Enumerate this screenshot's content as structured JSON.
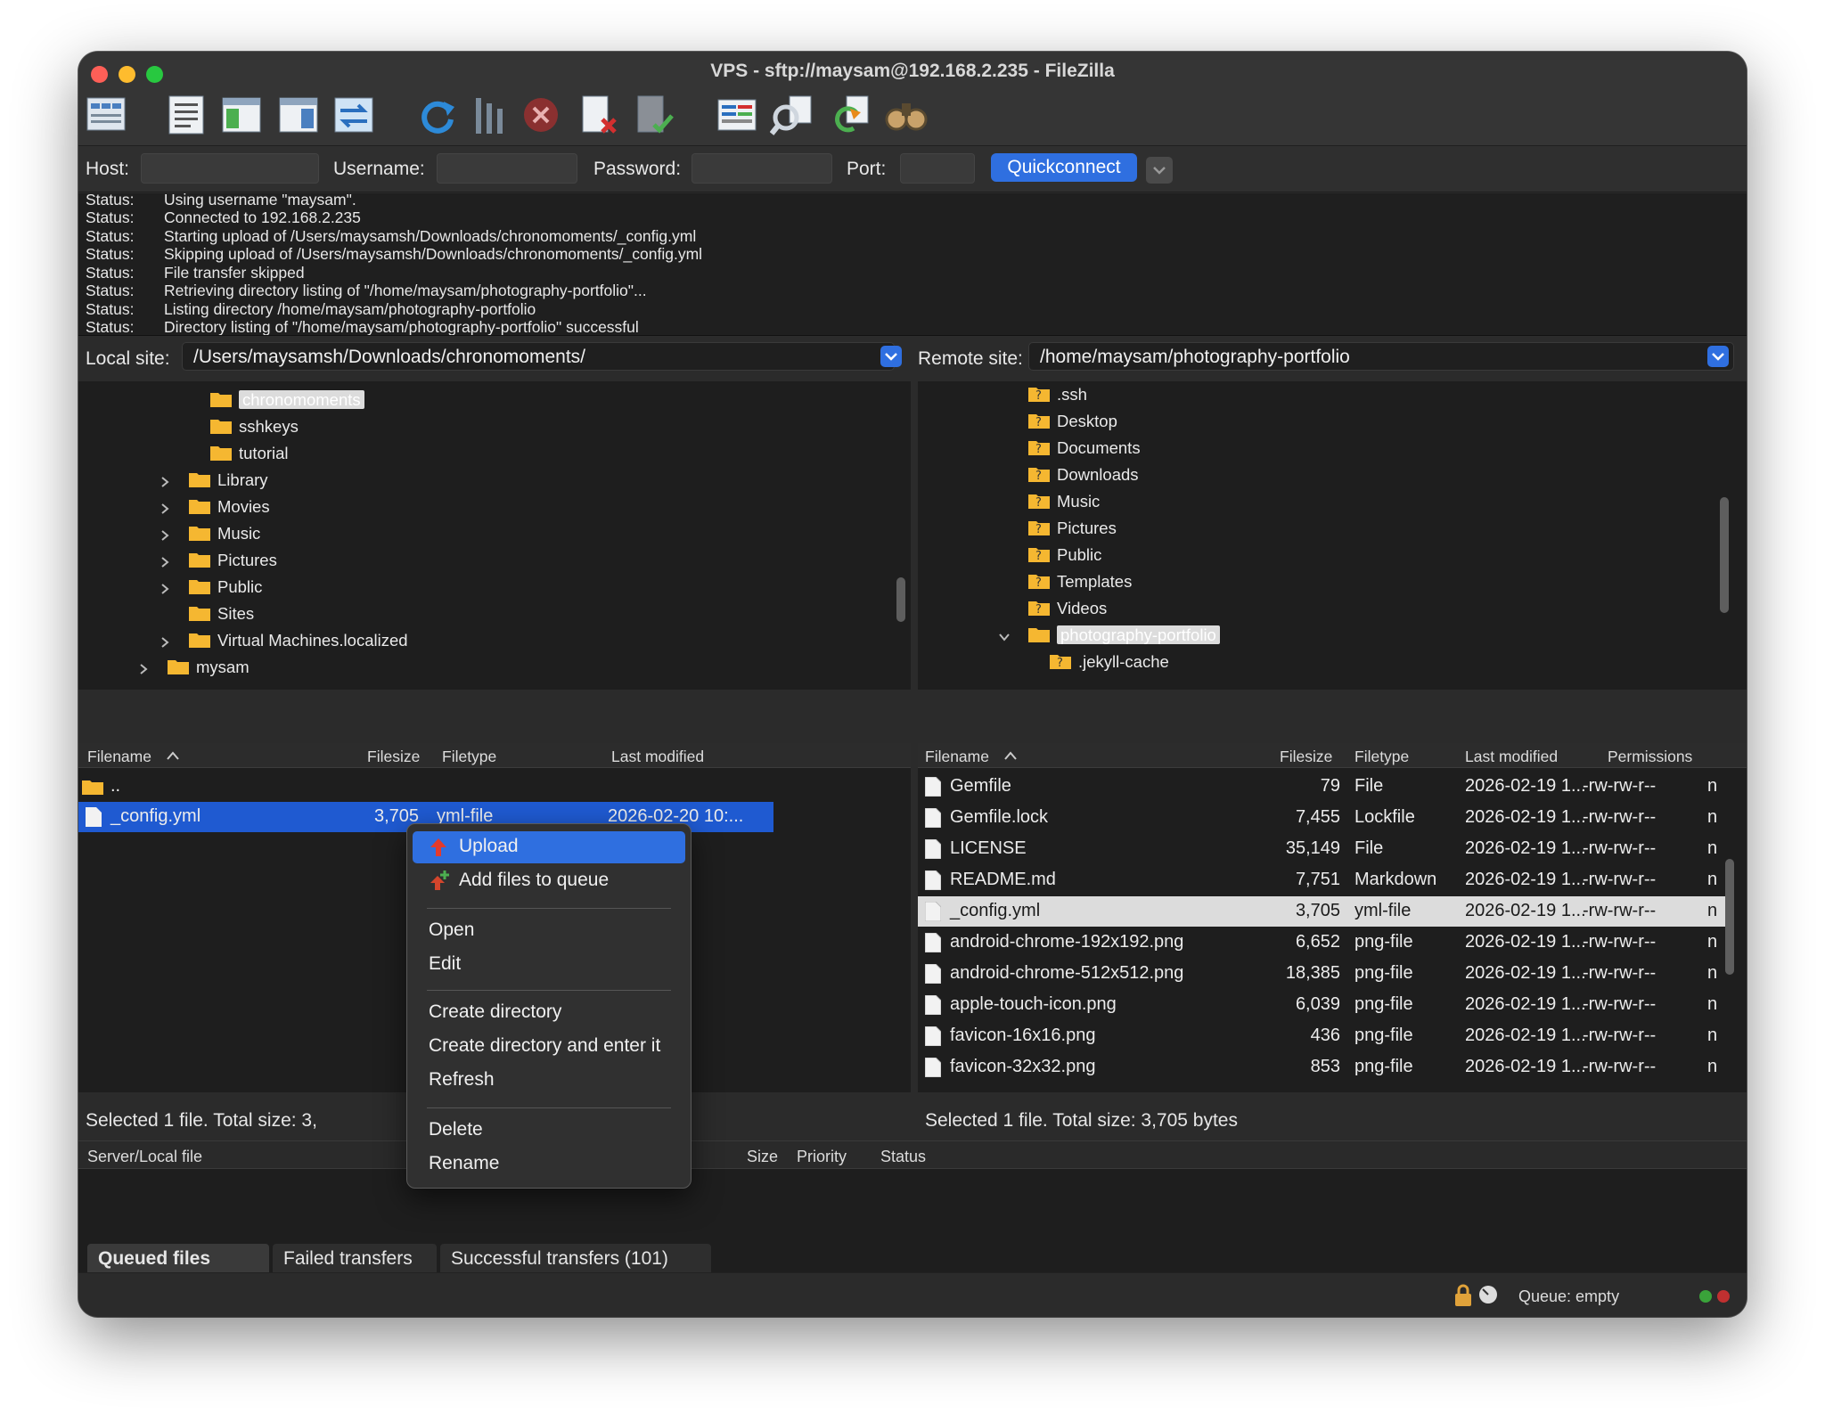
{
  "window": {
    "title": "VPS - sftp://maysam@192.168.2.235 - FileZilla"
  },
  "toolbar": {
    "icons": [
      "site-manager-icon",
      "message-log-icon",
      "local-tree-icon",
      "remote-tree-icon",
      "transfer-queue-icon",
      "refresh-icon",
      "process-queue-icon",
      "cancel-icon",
      "disconnect-icon",
      "reconnect-icon",
      "directory-comparison-icon",
      "filter-icon",
      "sync-browsing-icon",
      "search-icon"
    ]
  },
  "quickconnect": {
    "host_label": "Host:",
    "host_value": "",
    "username_label": "Username:",
    "username_value": "",
    "password_label": "Password:",
    "password_value": "",
    "port_label": "Port:",
    "port_value": "",
    "button": "Quickconnect"
  },
  "log": [
    {
      "type": "Status:",
      "text": "Using username \"maysam\"."
    },
    {
      "type": "Status:",
      "text": "Connected to 192.168.2.235"
    },
    {
      "type": "Status:",
      "text": "Starting upload of /Users/maysamsh/Downloads/chronomoments/_config.yml"
    },
    {
      "type": "Status:",
      "text": "Skipping upload of /Users/maysamsh/Downloads/chronomoments/_config.yml"
    },
    {
      "type": "Status:",
      "text": "File transfer skipped"
    },
    {
      "type": "Status:",
      "text": "Retrieving directory listing of \"/home/maysam/photography-portfolio\"..."
    },
    {
      "type": "Status:",
      "text": "Listing directory /home/maysam/photography-portfolio"
    },
    {
      "type": "Status:",
      "text": "Directory listing of \"/home/maysam/photography-portfolio\" successful"
    }
  ],
  "local": {
    "site_label": "Local site:",
    "path": "/Users/maysamsh/Downloads/chronomoments/",
    "tree": [
      "chronomoments",
      "sshkeys",
      "tutorial",
      "Library",
      "Movies",
      "Music",
      "Pictures",
      "Public",
      "Sites",
      "Virtual Machines.localized",
      "mysam"
    ],
    "columns": [
      "Filename",
      "Filesize",
      "Filetype",
      "Last modified"
    ],
    "parent": "..",
    "files": [
      {
        "name": "_config.yml",
        "size": "3,705",
        "type": "yml-file",
        "modified": "2026-02-20 10:..."
      }
    ],
    "status": "Selected 1 file. Total size: 3,"
  },
  "remote": {
    "site_label": "Remote site:",
    "path": "/home/maysam/photography-portfolio",
    "tree": [
      ".ssh",
      "Desktop",
      "Documents",
      "Downloads",
      "Music",
      "Pictures",
      "Public",
      "Templates",
      "Videos",
      "photography-portfolio",
      ".jekyll-cache"
    ],
    "columns": [
      "Filename",
      "Filesize",
      "Filetype",
      "Last modified",
      "Permissions"
    ],
    "files": [
      {
        "name": "Gemfile",
        "size": "79",
        "type": "File",
        "modified": "2026-02-19 1...",
        "perms": "-rw-rw-r--",
        "owner": "n"
      },
      {
        "name": "Gemfile.lock",
        "size": "7,455",
        "type": "Lockfile",
        "modified": "2026-02-19 1...",
        "perms": "-rw-rw-r--",
        "owner": "n"
      },
      {
        "name": "LICENSE",
        "size": "35,149",
        "type": "File",
        "modified": "2026-02-19 1...",
        "perms": "-rw-rw-r--",
        "owner": "n"
      },
      {
        "name": "README.md",
        "size": "7,751",
        "type": "Markdown",
        "modified": "2026-02-19 1...",
        "perms": "-rw-rw-r--",
        "owner": "n"
      },
      {
        "name": "_config.yml",
        "size": "3,705",
        "type": "yml-file",
        "modified": "2026-02-19 1...",
        "perms": "-rw-rw-r--",
        "owner": "n"
      },
      {
        "name": "android-chrome-192x192.png",
        "size": "6,652",
        "type": "png-file",
        "modified": "2026-02-19 1...",
        "perms": "-rw-rw-r--",
        "owner": "n"
      },
      {
        "name": "android-chrome-512x512.png",
        "size": "18,385",
        "type": "png-file",
        "modified": "2026-02-19 1...",
        "perms": "-rw-rw-r--",
        "owner": "n"
      },
      {
        "name": "apple-touch-icon.png",
        "size": "6,039",
        "type": "png-file",
        "modified": "2026-02-19 1...",
        "perms": "-rw-rw-r--",
        "owner": "n"
      },
      {
        "name": "favicon-16x16.png",
        "size": "436",
        "type": "png-file",
        "modified": "2026-02-19 1...",
        "perms": "-rw-rw-r--",
        "owner": "n"
      },
      {
        "name": "favicon-32x32.png",
        "size": "853",
        "type": "png-file",
        "modified": "2026-02-19 1...",
        "perms": "-rw-rw-r--",
        "owner": "n"
      }
    ],
    "status": "Selected 1 file. Total size: 3,705 bytes"
  },
  "context_menu": {
    "items": [
      "Upload",
      "Add files to queue",
      "Open",
      "Edit",
      "Create directory",
      "Create directory and enter it",
      "Refresh",
      "Delete",
      "Rename"
    ]
  },
  "queue": {
    "columns": [
      "Server/Local file",
      "Size",
      "Priority",
      "Status"
    ],
    "tabs": [
      "Queued files",
      "Failed transfers",
      "Successful transfers (101)"
    ],
    "footer_status": "Queue: empty"
  },
  "colors": {
    "accent": "#2f6fe0",
    "selection": "#1f5ad1",
    "folder": "#f5b731"
  }
}
